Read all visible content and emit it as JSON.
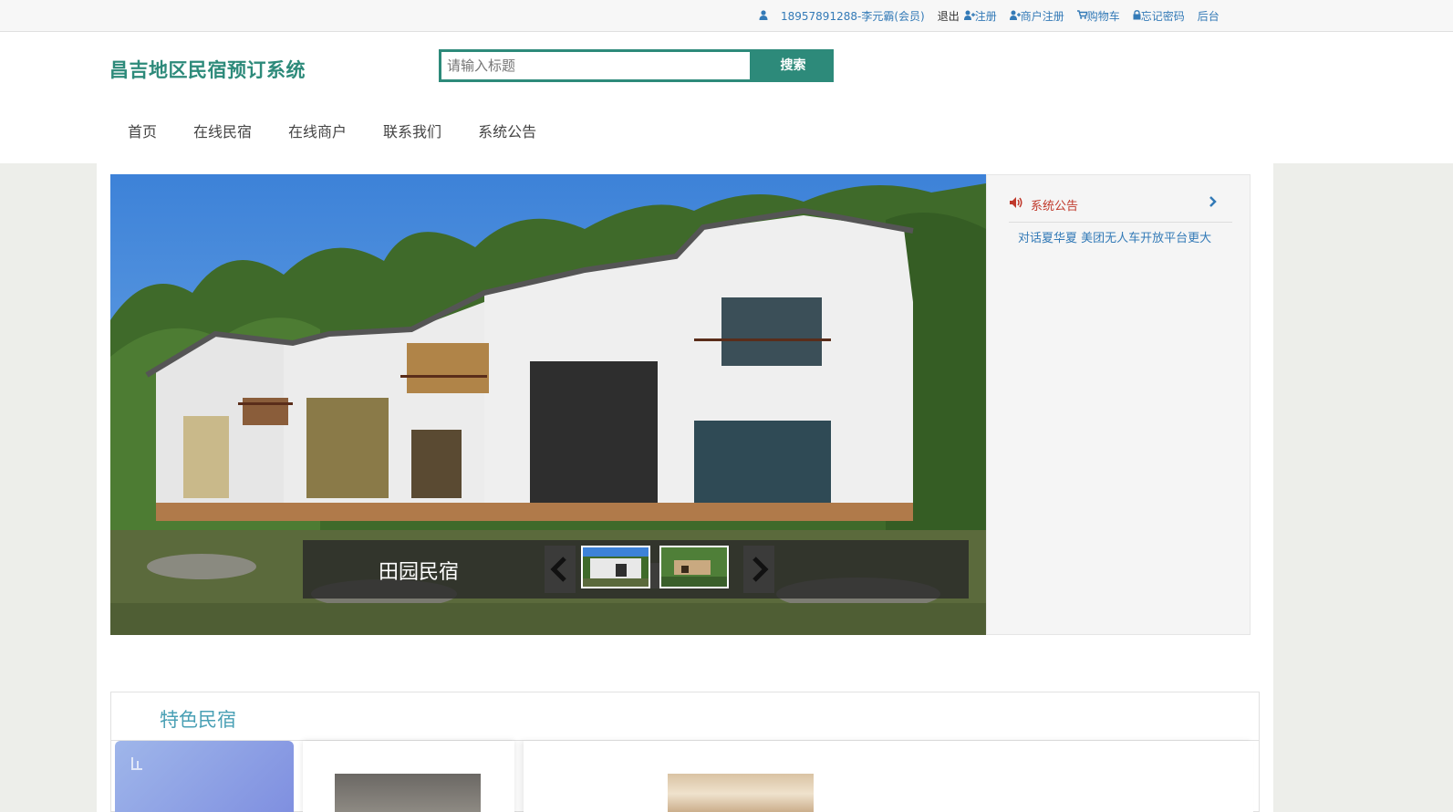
{
  "topbar": {
    "user_info": "18957891288-李元霸(会员)",
    "logout": "退出",
    "register": "注册",
    "merchant_register": "商户注册",
    "cart": "购物车",
    "forgot_password": "忘记密码",
    "admin": "后台"
  },
  "header": {
    "site_title": "昌吉地区民宿预订系统",
    "search_placeholder": "请输入标题",
    "search_button": "搜索"
  },
  "nav": {
    "items": [
      "首页",
      "在线民宿",
      "在线商户",
      "联系我们",
      "系统公告"
    ]
  },
  "carousel": {
    "caption": "田园民宿",
    "prev": "‹",
    "next": "›"
  },
  "notice": {
    "title": "系统公告",
    "items": [
      "对话夏华夏 美团无人车开放平台更大"
    ]
  },
  "feature": {
    "title": "特色民宿"
  },
  "colors": {
    "accent": "#2d8a7a",
    "link": "#337ab7",
    "notice_title": "#c0392b",
    "feature_title": "#4aa0b5"
  }
}
